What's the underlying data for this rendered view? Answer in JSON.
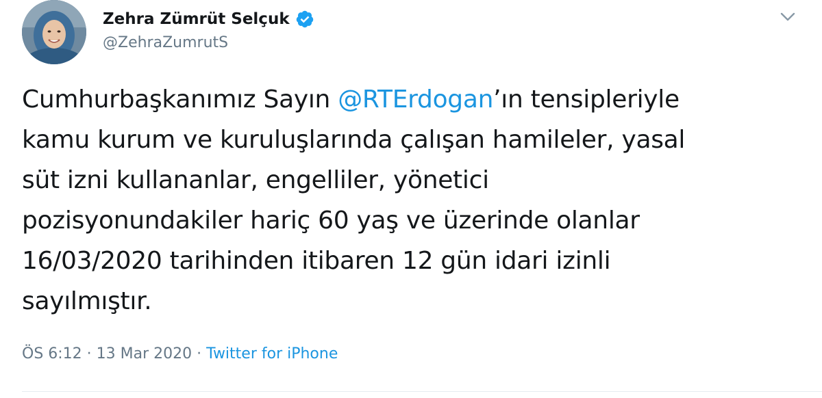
{
  "author": {
    "display_name": "Zehra Zümrüt Selçuk",
    "handle": "@ZehraZumrutS",
    "verified": true,
    "avatar_icon": "profile-photo"
  },
  "tweet": {
    "lines": [
      {
        "before": "Cumhurbaşkanımız Sayın ",
        "mention": "@RTErdogan",
        "after": "’ın tensipleriyle"
      },
      {
        "text": "kamu kurum ve kuruluşlarında çalışan hamileler, yasal"
      },
      {
        "text": "süt izni kullananlar, engelliler, yönetici"
      },
      {
        "text": "pozisyonundakiler hariç 60 yaş ve üzerinde olanlar"
      },
      {
        "text": "16/03/2020 tarihinden itibaren 12 gün idari izinli"
      },
      {
        "text": "sayılmıştır."
      }
    ]
  },
  "meta": {
    "time": "ÖS 6:12",
    "separator1": " · ",
    "date": "13 Mar 2020",
    "separator2": " · ",
    "source": "Twitter for iPhone"
  },
  "colors": {
    "link": "#1b95e0",
    "text": "#14171a",
    "secondary": "#657786",
    "verified_badge": "#1da1f2"
  },
  "icons": {
    "verified": "verified-badge-icon",
    "menu": "chevron-down-icon"
  }
}
